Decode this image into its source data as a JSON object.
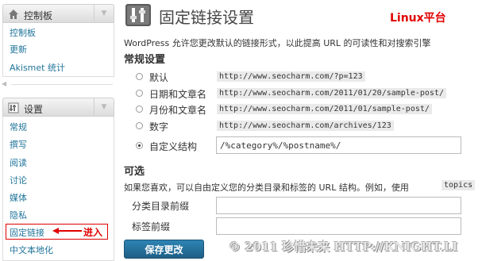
{
  "sidebar": {
    "dashboard": {
      "title": "控制板",
      "items": [
        "控制板",
        "更新",
        "Akismet 统计"
      ]
    },
    "settings": {
      "title": "设置",
      "items": [
        "常规",
        "撰写",
        "阅读",
        "讨论",
        "媒体",
        "隐私",
        "固定链接",
        "中文本地化"
      ]
    },
    "annotation": "进入"
  },
  "main": {
    "title": "固定链接设置",
    "platform_tag": "Linux平台",
    "intro": "WordPress 允许您更改默认的链接形式，以此提高 URL 的可读性和对搜索引擎",
    "common": {
      "heading": "常规设置",
      "options": [
        {
          "label": "默认",
          "example": "http://www.seocharm.com/?p=123",
          "checked": false
        },
        {
          "label": "日期和文章名",
          "example": "http://www.seocharm.com/2011/01/20/sample-post/",
          "checked": false
        },
        {
          "label": "月份和文章名",
          "example": "http://www.seocharm.com/2011/01/sample-post/",
          "checked": false
        },
        {
          "label": "数字",
          "example": "http://www.seocharm.com/archives/123",
          "checked": false
        },
        {
          "label": "自定义结构",
          "checked": true
        }
      ],
      "custom_structure_value": "/%category%/%postname%/"
    },
    "optional": {
      "heading": "可选",
      "description": "如果您喜欢，可以自由定义您的分类目录和标签的 URL 结构。例如，使用",
      "code": "topics",
      "category_base_label": "分类目录前缀",
      "category_base_value": "",
      "tag_base_label": "标签前缀",
      "tag_base_value": ""
    },
    "save_label": "保存更改",
    "watermark": "© 2011 珍惜未来 HTTP://KNIGHT.LI"
  },
  "colors": {
    "link": "#21759b",
    "annotation_red": "#e00000",
    "button_blue": "#21759b"
  }
}
